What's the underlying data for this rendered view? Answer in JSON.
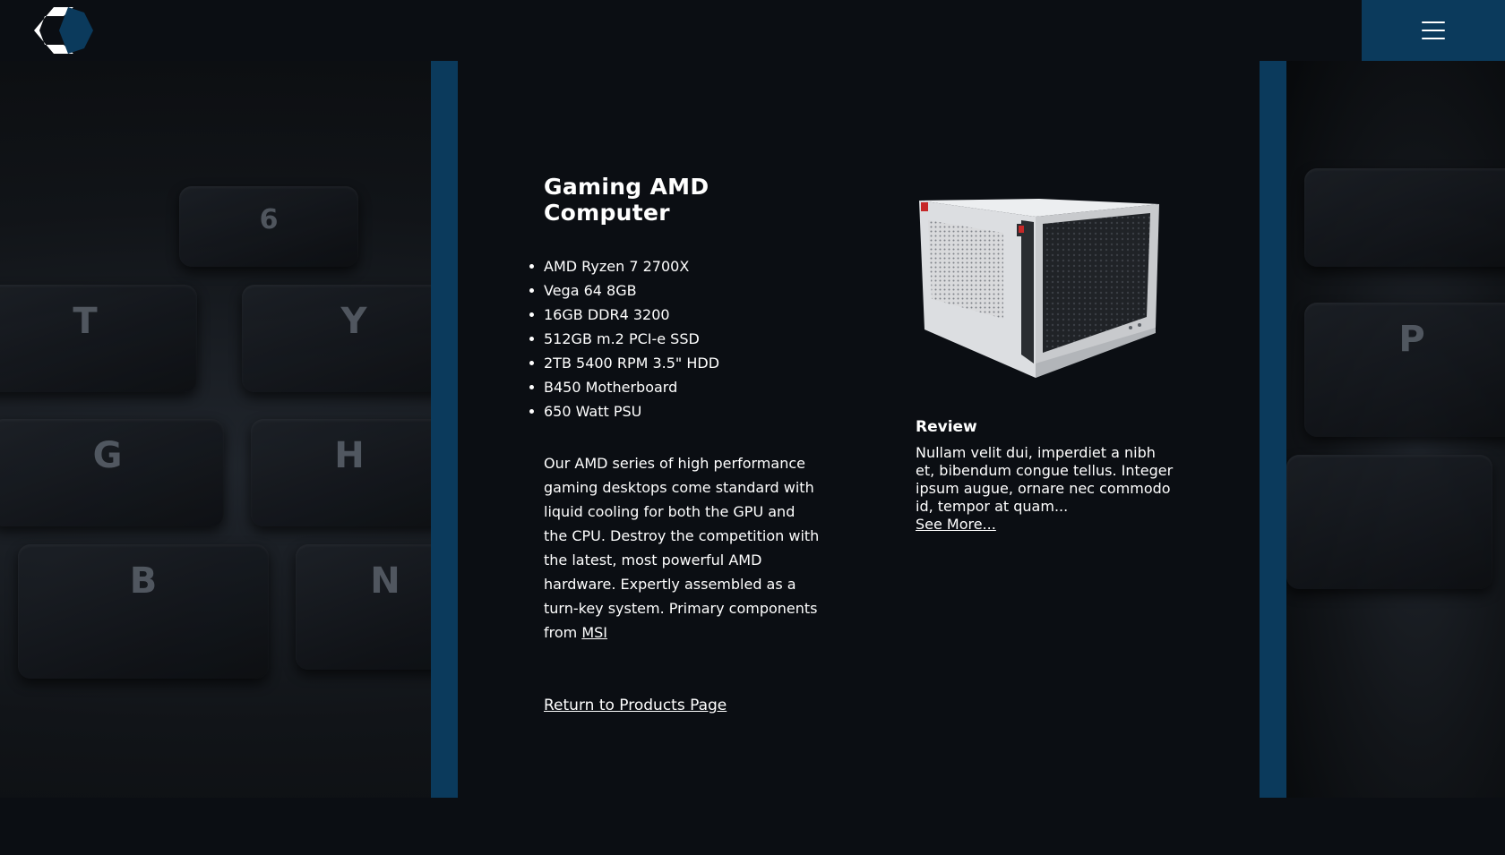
{
  "header": {
    "logo_icon": "hexagon-c-logo-icon",
    "menu_icon": "hamburger-menu-icon",
    "accent_color": "#0b3a5c"
  },
  "background": {
    "keys_left": [
      "T",
      "Y",
      "G",
      "H",
      "B",
      "N",
      "6"
    ],
    "keys_right": [
      "P"
    ]
  },
  "product": {
    "title": "Gaming AMD Computer",
    "specs": [
      "AMD Ryzen 7 2700X",
      "Vega 64 8GB",
      "16GB DDR4 3200",
      "512GB m.2 PCI-e SSD",
      "2TB 5400 RPM 3.5\" HDD",
      "B450 Motherboard",
      "650 Watt PSU"
    ],
    "description": "Our AMD series of high performance gaming desktops come standard with liquid cooling for both the GPU and the CPU. Destroy the competition with the latest, most powerful AMD hardware. Expertly assembled as a turn-key system. Primary components from ",
    "manufacturer_link": "MSI",
    "return_link": "Return to Products Page",
    "image_icon": "pc-case-image"
  },
  "review": {
    "heading": "Review",
    "text": "Nullam velit dui, imperdiet a nibh et, bibendum congue tellus. Integer ipsum augue, ornare nec commodo id, tempor at quam...",
    "see_more": "See More..."
  }
}
